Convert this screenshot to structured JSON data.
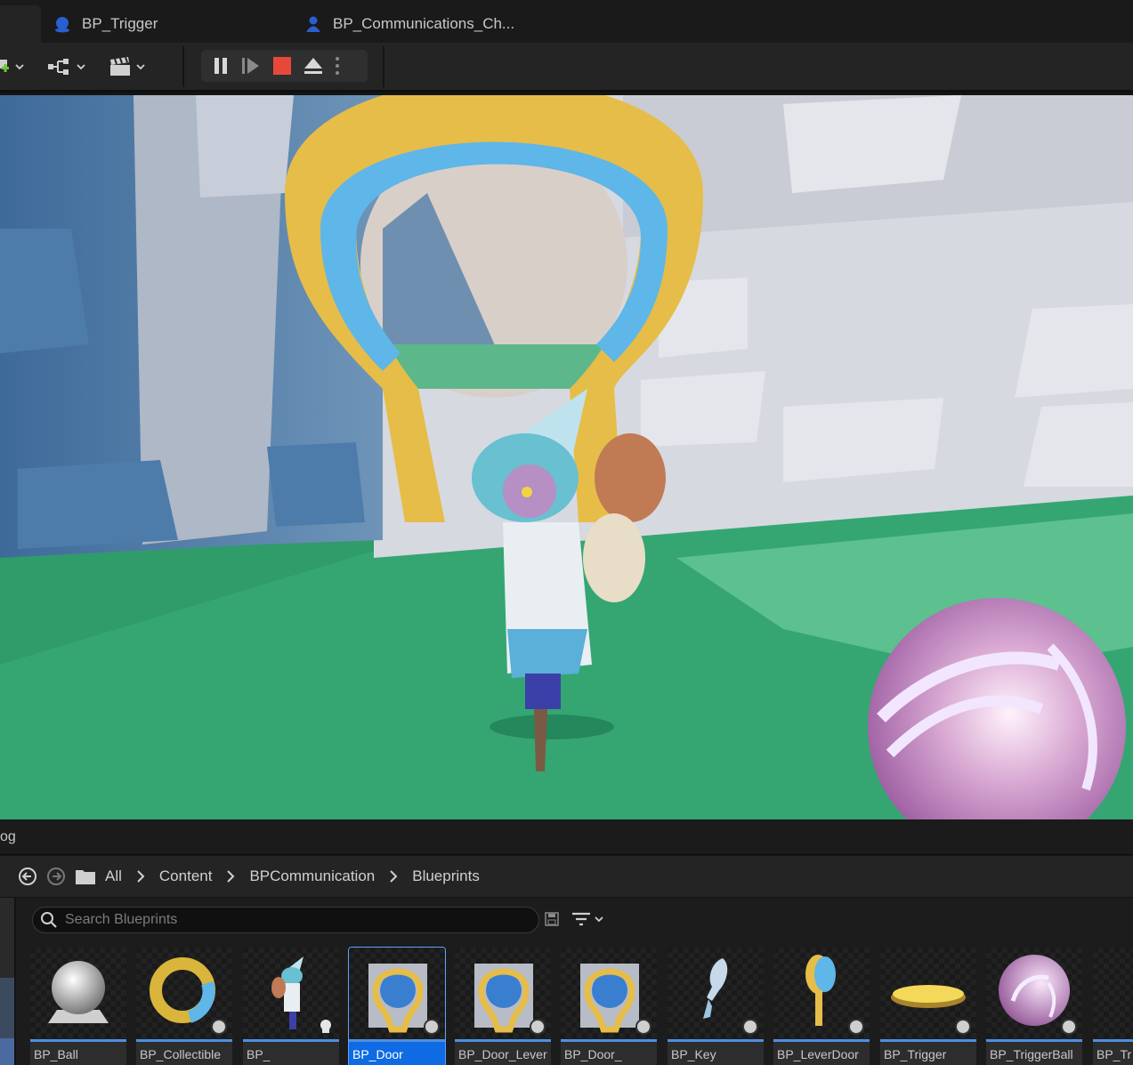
{
  "tabs": [
    {
      "label": "BP_Trigger",
      "icon": "blueprint-actor-icon"
    },
    {
      "label": "BP_Communications_Ch...",
      "icon": "blueprint-character-icon"
    }
  ],
  "toolbar": {
    "buttons": [
      "add-actor-button",
      "blueprint-menu-button",
      "cinematics-menu-button"
    ],
    "playback": [
      "pause-button",
      "frame-skip-button",
      "stop-button",
      "eject-button",
      "playback-options-button"
    ]
  },
  "drawer": {
    "title": "og"
  },
  "breadcrumb": {
    "items": [
      "All",
      "Content",
      "BPCommunication",
      "Blueprints"
    ]
  },
  "search": {
    "placeholder": "Search Blueprints"
  },
  "assets": [
    {
      "label": "BP_Ball"
    },
    {
      "label": "BP_Collectible"
    },
    {
      "label": "BP_"
    },
    {
      "label": "BP_Door"
    },
    {
      "label": "BP_Door_Lever"
    },
    {
      "label": "BP_Door_"
    },
    {
      "label": "BP_Key"
    },
    {
      "label": "BP_LeverDoor"
    },
    {
      "label": "BP_Trigger"
    },
    {
      "label": "BP_TriggerBall"
    },
    {
      "label": "BP_Tr"
    }
  ],
  "colors": {
    "accent": "#0e6be3",
    "stop": "#e8483a",
    "asset_bar": "#4f8fe0"
  }
}
